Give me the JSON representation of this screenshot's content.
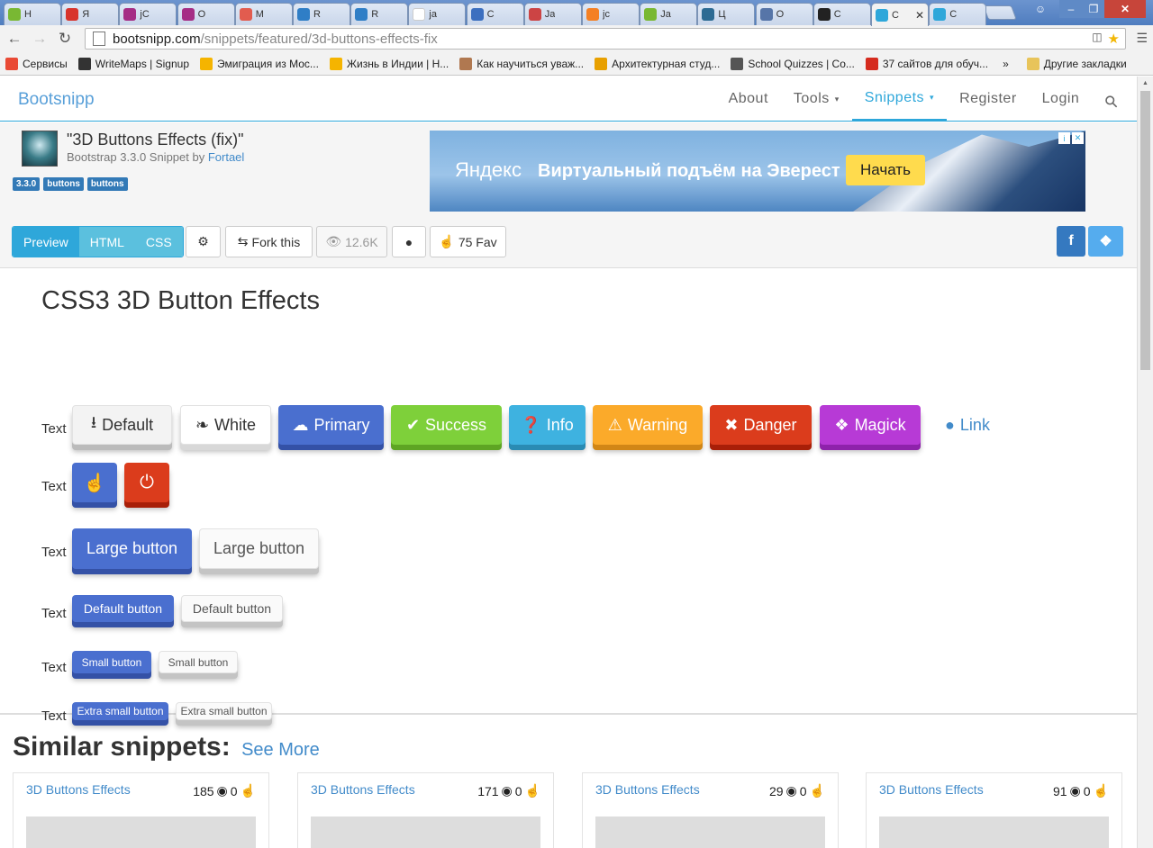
{
  "browser": {
    "tabs": [
      {
        "label": "H",
        "fav": "wd-icon",
        "color": "#79b833"
      },
      {
        "label": "Я",
        "fav": "opera-icon",
        "color": "#d8342c"
      },
      {
        "label": "jC",
        "fav": "n-icon",
        "color": "#a52d85"
      },
      {
        "label": "O",
        "fav": "n-icon",
        "color": "#a52d85"
      },
      {
        "label": "М",
        "fav": "person-icon",
        "color": "#e25c4f"
      },
      {
        "label": "R",
        "fav": "r-icon",
        "color": "#2f7ec6"
      },
      {
        "label": "R",
        "fav": "r-icon",
        "color": "#2f7ec6"
      },
      {
        "label": "ja",
        "fav": "google-icon",
        "color": "#ffffff"
      },
      {
        "label": "C",
        "fav": "mail-icon",
        "color": "#3c6fbf"
      },
      {
        "label": "Ja",
        "fav": "chart-icon",
        "color": "#cc4444"
      },
      {
        "label": "jc",
        "fav": "stack-icon",
        "color": "#f48024"
      },
      {
        "label": "Ja",
        "fav": "wd-icon",
        "color": "#79b833"
      },
      {
        "label": "Ц",
        "fav": "u-icon",
        "color": "#2d6b93"
      },
      {
        "label": "O",
        "fav": "h-icon",
        "color": "#5675a8"
      },
      {
        "label": "C",
        "fav": "spy-icon",
        "color": "#222222"
      },
      {
        "label": "C",
        "fav": "bs-icon",
        "color": "#2ea7da",
        "active": true
      },
      {
        "label": "C",
        "fav": "bs-icon",
        "color": "#2ea7da"
      }
    ],
    "url_host": "bootsnipp.com",
    "url_path": "/snippets/featured/3d-buttons-effects-fix",
    "bookmarks": [
      {
        "label": "Сервисы",
        "color": "#e94a35"
      },
      {
        "label": "WriteMaps | Signup",
        "color": "#333333"
      },
      {
        "label": "Эмиграция из Мос...",
        "color": "#f5b400"
      },
      {
        "label": "Жизнь в Индии | Н...",
        "color": "#f5b400"
      },
      {
        "label": "Как научиться уваж...",
        "color": "#b07850"
      },
      {
        "label": "Архитектурная студ...",
        "color": "#e8a000"
      },
      {
        "label": "School Quizzes | Co...",
        "color": "#555555"
      },
      {
        "label": "37 сайтов для обуч...",
        "color": "#d52b1e"
      }
    ],
    "bookmarks_more": "»",
    "other_bookmarks": "Другие закладки"
  },
  "site": {
    "brand": "Bootsnipp",
    "nav": [
      {
        "label": "About"
      },
      {
        "label": "Tools",
        "caret": true
      },
      {
        "label": "Snippets",
        "caret": true,
        "active": true
      },
      {
        "label": "Register"
      },
      {
        "label": "Login"
      }
    ]
  },
  "snippet": {
    "title": "\"3D Buttons Effects (fix)\"",
    "subtitle_prefix": "Bootstrap 3.3.0 Snippet by ",
    "author": "Fortael",
    "labels": [
      "3.3.0",
      "buttons",
      "buttons"
    ]
  },
  "ad": {
    "logo": "Яндекс",
    "text": "Виртуальный подъём на Эверест",
    "button": "Начать"
  },
  "toolbar": {
    "preview": "Preview",
    "html": "HTML",
    "css": "CSS",
    "fork": "Fork this",
    "views": "12.6K",
    "fav": "75 Fav"
  },
  "demo": {
    "heading": "CSS3 3D Button Effects",
    "row_label": "Text",
    "row1": [
      {
        "label": "Default",
        "icon": "download-icon",
        "bg": "#f3f3f3",
        "shadow": "#bbbbbb",
        "fg": "#333333"
      },
      {
        "label": "White",
        "icon": "tag-icon",
        "bg": "#ffffff",
        "shadow": "#d8d8d8",
        "fg": "#333333"
      },
      {
        "label": "Primary",
        "icon": "cloud-icon",
        "bg": "#4a6fcf",
        "shadow": "#3451a6",
        "fg": "#ffffff"
      },
      {
        "label": "Success",
        "icon": "check-icon",
        "bg": "#7ed03a",
        "shadow": "#5ea523",
        "fg": "#ffffff"
      },
      {
        "label": "Info",
        "icon": "question-icon",
        "bg": "#3eb2e0",
        "shadow": "#2a8bb3",
        "fg": "#ffffff"
      },
      {
        "label": "Warning",
        "icon": "warning-icon",
        "bg": "#fbaa2a",
        "shadow": "#d18616",
        "fg": "#ffffff"
      },
      {
        "label": "Danger",
        "icon": "x-icon",
        "bg": "#db3c1c",
        "shadow": "#a81f08",
        "fg": "#ffffff"
      },
      {
        "label": "Magick",
        "icon": "gift-icon",
        "bg": "#b73ad6",
        "shadow": "#8e22ab",
        "fg": "#ffffff"
      },
      {
        "label": "Link",
        "icon": "globe-icon",
        "bg": "transparent",
        "shadow": "transparent",
        "fg": "#428bca"
      }
    ],
    "large_primary": "Large button",
    "large_default": "Large button",
    "default_primary": "Default button",
    "default_default": "Default button",
    "small_primary": "Small button",
    "small_default": "Small button",
    "xs_primary": "Extra small button",
    "xs_default": "Extra small button"
  },
  "similar": {
    "heading": "Similar snippets:",
    "see_more": "See More",
    "cards": [
      {
        "title": "3D Buttons Effects",
        "views": "185",
        "likes": "0"
      },
      {
        "title": "3D Buttons Effects",
        "views": "171",
        "likes": "0"
      },
      {
        "title": "3D Buttons Effects",
        "views": "29",
        "likes": "0"
      },
      {
        "title": "3D Buttons Effects",
        "views": "91",
        "likes": "0"
      }
    ]
  },
  "colors": {
    "accent": "#2ea7da",
    "primary": "#4a6fcf",
    "danger": "#db3c1c",
    "facebook": "#3b5998",
    "twitter": "#55acee"
  }
}
